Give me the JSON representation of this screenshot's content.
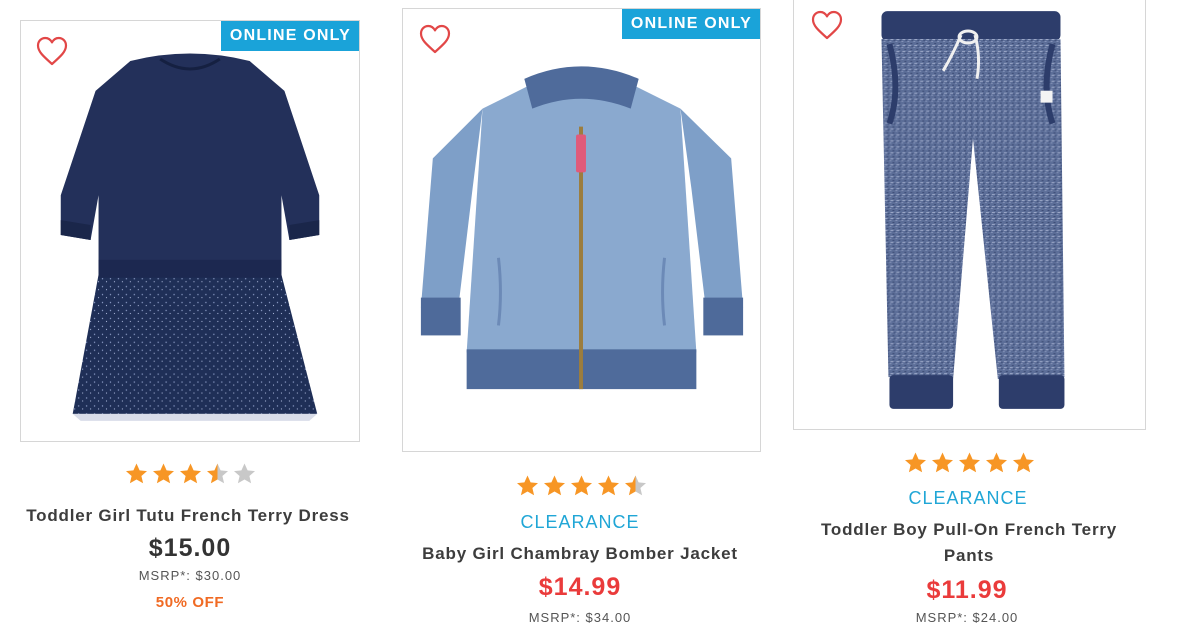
{
  "colors": {
    "badge_bg": "#1aa3d9",
    "star": "#f79625",
    "star_empty": "#c8c8c8",
    "heart": "#e24747",
    "sale_price": "#ea3b3b",
    "clearance": "#20a6d6",
    "discount": "#f06a23"
  },
  "products": [
    {
      "badge": "ONLINE ONLY",
      "wishlist_icon": "heart-outline-icon",
      "image": "navy-tutu-dress",
      "rating": 3.5,
      "rating_max": 5,
      "clearance": "",
      "name": "Toddler Girl Tutu French Terry Dress",
      "price": "$15.00",
      "msrp": "MSRP*: $30.00",
      "discount": "50% OFF"
    },
    {
      "badge": "ONLINE ONLY",
      "wishlist_icon": "heart-outline-icon",
      "image": "chambray-bomber-jacket",
      "rating": 4.5,
      "rating_max": 5,
      "clearance": "CLEARANCE",
      "name": "Baby Girl Chambray Bomber Jacket",
      "price": "$14.99",
      "msrp": "MSRP*: $34.00",
      "discount": ""
    },
    {
      "badge": "",
      "wishlist_icon": "heart-outline-icon",
      "image": "heather-navy-jogger-pants",
      "rating": 5,
      "rating_max": 5,
      "clearance": "CLEARANCE",
      "name_line1": "Toddler Boy Pull-On French Terry",
      "name_line2": "Pants",
      "price": "$11.99",
      "msrp": "MSRP*: $24.00",
      "discount": ""
    }
  ]
}
